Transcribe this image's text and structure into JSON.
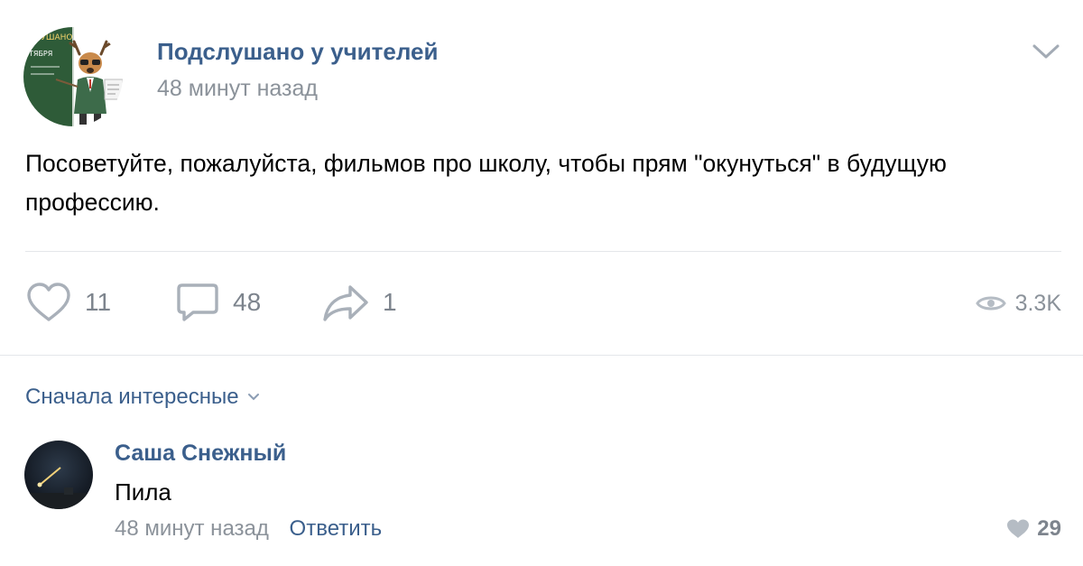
{
  "post": {
    "author": "Подслушано у учителей",
    "time": "48 минут назад",
    "avatar_text_top": "...ЛУШАНО",
    "avatar_text_board": "ТЯБРЯ",
    "text": "Посоветуйте, пожалуйста, фильмов про школу, чтобы прям \"окунуться\" в будущую профессию.",
    "actions": {
      "likes": "11",
      "comments": "48",
      "shares": "1",
      "views": "3.3K"
    }
  },
  "comments_section": {
    "sort_label": "Сначала интересные",
    "comments": [
      {
        "author": "Саша Снежный",
        "text": "Пила",
        "time": "48 минут назад",
        "reply_label": "Ответить",
        "likes": "29"
      }
    ]
  },
  "colors": {
    "link_blue": "#3b5f8c",
    "muted_gray": "#8b929a",
    "icon_gray": "#7d848d",
    "divider": "#e4e6ea",
    "avatar_board_green": "#2e5b38"
  },
  "icons": {
    "menu": "chevron-down-icon",
    "like": "heart-icon",
    "comment": "comment-icon",
    "share": "share-arrow-icon",
    "views": "eye-icon",
    "sort": "chevron-down-icon",
    "comment_like": "heart-filled-icon"
  }
}
